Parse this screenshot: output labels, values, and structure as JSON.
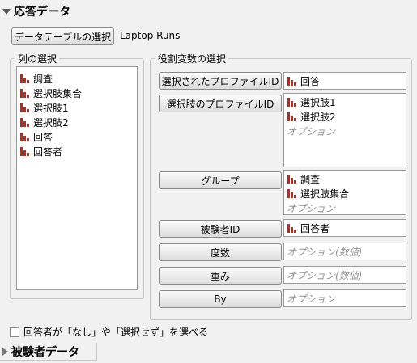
{
  "response": {
    "title": "応答データ",
    "select_table_button": "データテーブルの選択",
    "table_name": "Laptop Runs"
  },
  "columns": {
    "legend": "列の選択",
    "items": [
      "調査",
      "選択肢集合",
      "選択肢1",
      "選択肢2",
      "回答",
      "回答者"
    ]
  },
  "roles": {
    "legend": "役割変数の選択",
    "chosen_profile": {
      "button": "選択されたプロファイルID",
      "values": [
        "回答"
      ]
    },
    "choice_profile": {
      "button": "選択肢のプロファイルID",
      "values": [
        "選択肢1",
        "選択肢2"
      ],
      "placeholder": "オプション"
    },
    "group": {
      "button": "グループ",
      "values": [
        "調査",
        "選択肢集合"
      ],
      "placeholder": "オプション"
    },
    "subject": {
      "button": "被験者ID",
      "values": [
        "回答者"
      ]
    },
    "freq": {
      "button": "度数",
      "placeholder": "オプション(数値)"
    },
    "weight": {
      "button": "重み",
      "placeholder": "オプション(数値)"
    },
    "by": {
      "button": "By",
      "placeholder": "オプション"
    }
  },
  "option_none": {
    "label": "回答者が「なし」や「選択せず」を選べる",
    "checked": false
  },
  "subject_section": {
    "title": "被験者データ"
  },
  "colors": {
    "nominal_icon": "#c0281c",
    "panel_bg": "#f1f1f1"
  },
  "icons": {
    "column_type": "nominal-bar-icon"
  }
}
